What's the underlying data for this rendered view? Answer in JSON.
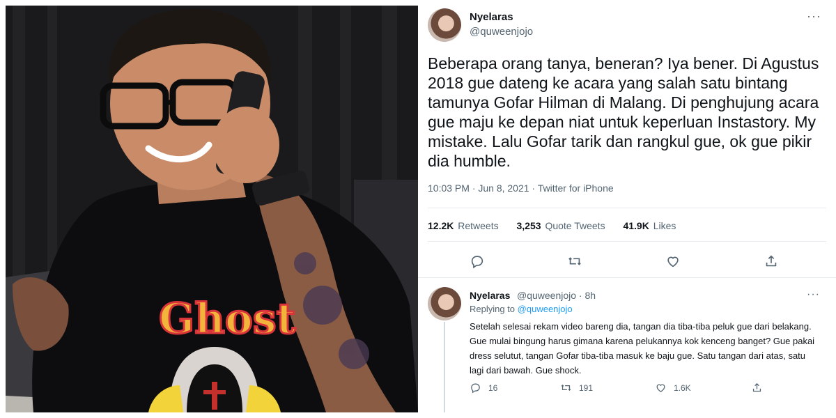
{
  "photo": {
    "alt_icon": "photo-man-on-phone",
    "shirt_print": "Ghost"
  },
  "tweet": {
    "display_name": "Nyelaras",
    "handle": "@quweenjojo",
    "text": "Beberapa orang tanya, beneran? Iya bener. Di Agustus 2018 gue dateng ke acara yang salah satu bintang tamunya Gofar Hilman di Malang. Di penghujung acara gue maju ke depan niat untuk keperluan Instastory. My mistake. Lalu Gofar tarik dan rangkul gue, ok gue pikir dia humble.",
    "time": "10:03 PM · Jun 8, 2021 · Twitter for iPhone",
    "stats": {
      "retweets_count": "12.2K",
      "retweets_label": "Retweets",
      "quotes_count": "3,253",
      "quotes_label": "Quote Tweets",
      "likes_count": "41.9K",
      "likes_label": "Likes"
    },
    "icons": [
      "reply-icon",
      "retweet-icon",
      "like-icon",
      "share-icon",
      "more-icon"
    ]
  },
  "reply": {
    "display_name": "Nyelaras",
    "handle_time": "@quweenjojo · 8h",
    "replying_prefix": "Replying to",
    "replying_mention": "@quweenjojo",
    "text": "Setelah selesai rekam video bareng dia, tangan dia tiba-tiba peluk gue dari belakang. Gue mulai bingung harus gimana karena pelukannya kok kenceng banget? Gue pakai dress selutut, tangan Gofar tiba-tiba masuk ke baju gue. Satu tangan dari atas, satu lagi dari bawah. Gue shock.",
    "replies": "16",
    "retweets": "191",
    "likes": "1.6K"
  },
  "colors": {
    "text_primary": "#0f1419",
    "text_secondary": "#536471",
    "link": "#1d9bf0",
    "divider": "#e6ebee"
  }
}
